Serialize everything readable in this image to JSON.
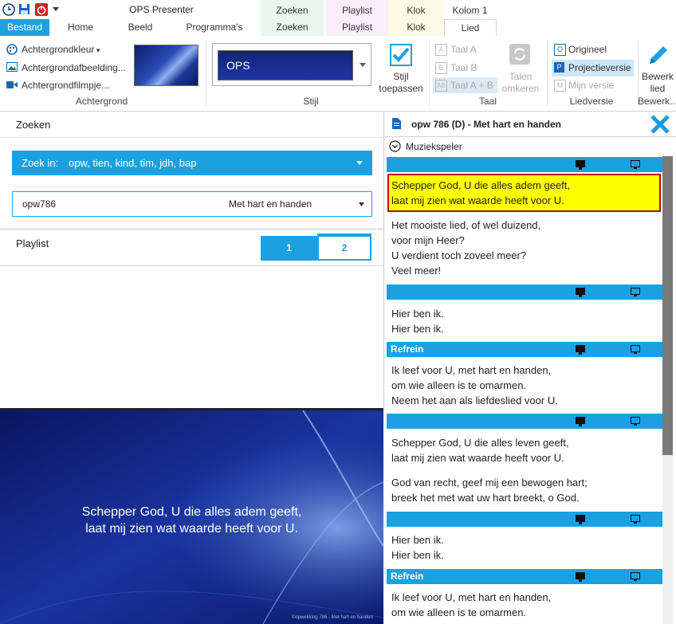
{
  "app": {
    "title": "OPS Presenter",
    "file_tab": "Bestand",
    "tabs": [
      "Home",
      "Beeld",
      "Programma's"
    ],
    "context_headers": [
      "Zoeken",
      "Playlist",
      "Klok",
      "Kolom 1"
    ],
    "context_tabs": [
      "Zoeken",
      "Playlist",
      "Klok",
      "Lied"
    ]
  },
  "ribbon": {
    "background": {
      "color_label": "Achtergrondkleur",
      "image_label": "Achtergrondafbeelding...",
      "video_label": "Achtergrondfilmpje...",
      "group_label": "Achtergrond"
    },
    "style": {
      "preview_text": "OPS",
      "group_label": "Stijl",
      "apply_line1": "Stijl",
      "apply_line2": "toepassen"
    },
    "language": {
      "lang_a": "Taal A",
      "lang_b": "Taal B",
      "lang_ab": "Taal A + B",
      "swap_line1": "Talen",
      "swap_line2": "omkeren",
      "group_label": "Taal"
    },
    "song_version": {
      "original": "Origineel",
      "projection": "Projectieversie",
      "mine": "Mijn versie",
      "group_label": "Liedversie"
    },
    "edit": {
      "line1": "Bewerk",
      "line2": "lied",
      "group_label": "Bewerk..."
    }
  },
  "search": {
    "header": "Zoeken",
    "search_in_label": "Zoek in:",
    "search_in_value": "opw, tien, kind, tim, jdh, bap",
    "result_code": "opw786",
    "result_title": "Met hart en handen"
  },
  "playlist": {
    "header": "Playlist",
    "pages": [
      "1",
      "2"
    ]
  },
  "preview": {
    "line1": "Schepper God, U die alles adem geeft,",
    "line2": "laat mij zien wat waarde heeft voor U.",
    "footer": "©opwekking 786 - Met hart en handen"
  },
  "song": {
    "title": "opw 786 (D) - Met hart en handen",
    "music_player": "Muziekspeler",
    "sections": [
      {
        "label": "",
        "lines": [
          "Schepper God, U die alles adem geeft,",
          "laat mij zien wat waarde heeft voor U."
        ],
        "lines2": [
          "Het mooiste lied, of wel duizend,",
          "voor mijn Heer?",
          "U verdient toch zoveel meer?",
          "Veel meer!"
        ]
      },
      {
        "label": "",
        "lines": [
          "Hier ben ik.",
          "Hier ben ik."
        ]
      },
      {
        "label": "Refrein",
        "lines": [
          "Ik leef voor U, met hart en handen,",
          "om wie alleen is te omarmen.",
          "Neem het aan als liefdeslied voor U."
        ]
      },
      {
        "label": "",
        "lines": [
          "Schepper God, U die alles leven geeft,",
          "laat mij zien wat waarde heeft voor U."
        ],
        "lines2": [
          "God van recht, geef mij een bewogen hart;",
          "breek het met wat uw hart breekt, o God."
        ]
      },
      {
        "label": "",
        "lines": [
          "Hier ben ik.",
          "Hier ben ik."
        ]
      },
      {
        "label": "Refrein",
        "lines": [
          "Ik leef voor U, met hart en handen,",
          "om wie alleen is te omarmen."
        ]
      }
    ]
  },
  "colors": {
    "accent": "#1ba1e2",
    "highlight": "#ffff00",
    "highlight_border": "#c00000"
  }
}
